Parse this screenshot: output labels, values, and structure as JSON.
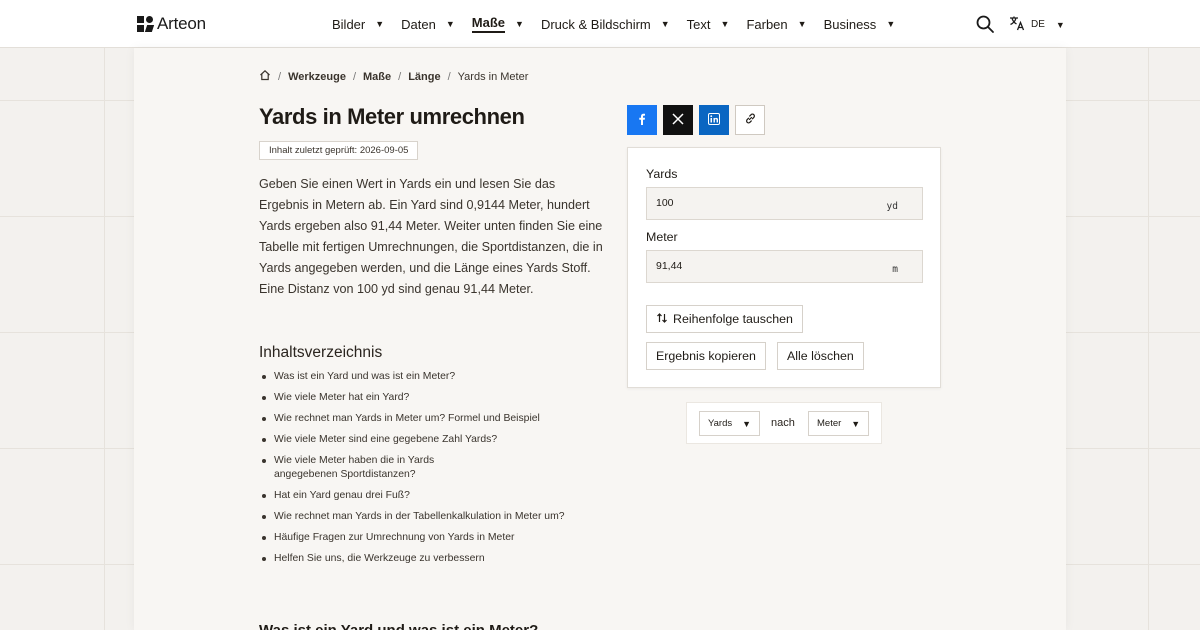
{
  "brand": {
    "name": "Arteon"
  },
  "nav": {
    "items": [
      {
        "label": "Bilder",
        "active": false
      },
      {
        "label": "Daten",
        "active": false
      },
      {
        "label": "Maße",
        "active": true
      },
      {
        "label": "Druck & Bildschirm",
        "active": false
      },
      {
        "label": "Text",
        "active": false
      },
      {
        "label": "Farben",
        "active": false
      },
      {
        "label": "Business",
        "active": false
      }
    ],
    "language": "DE"
  },
  "breadcrumb": {
    "items": [
      "Werkzeuge",
      "Maße",
      "Länge",
      "Yards in Meter"
    ]
  },
  "page": {
    "title": "Yards in Meter umrechnen",
    "checked_badge": "Inhalt zuletzt geprüft: 2026-09-05",
    "intro": "Geben Sie einen Wert in Yards ein und lesen Sie das Ergebnis in Metern ab. Ein Yard sind 0,9144 Meter, hundert Yards ergeben also 91,44 Meter. Weiter unten finden Sie eine Tabelle mit fertigen Umrechnungen, die Sportdistanzen, die in Yards angegeben werden, und die Länge eines Yards Stoff. Eine Distanz von 100 yd sind genau 91,44 Meter."
  },
  "toc": {
    "heading": "Inhaltsverzeichnis",
    "items": [
      "Was ist ein Yard und was ist ein Meter?",
      "Wie viele Meter hat ein Yard?",
      "Wie rechnet man Yards in Meter um? Formel und Beispiel",
      "Wie viele Meter sind eine gegebene Zahl Yards?",
      "Wie viele Meter haben die in Yards angegebenen Sportdistanzen?",
      "Hat ein Yard genau drei Fuß?",
      "Wie rechnet man Yards in der Tabellenkalkulation in Meter um?",
      "Häufige Fragen zur Umrechnung von Yards in Meter",
      "Helfen Sie uns, die Werkzeuge zu verbessern"
    ]
  },
  "next_section": {
    "heading": "Was ist ein Yard und was ist ein Meter?"
  },
  "share": {
    "facebook_icon": "facebook-icon",
    "x_icon": "x-icon",
    "linkedin_icon": "linkedin-icon",
    "link_icon": "link-icon"
  },
  "converter": {
    "from": {
      "label": "Yards",
      "value": "100",
      "unit": "yd"
    },
    "to": {
      "label": "Meter",
      "value": "91,44",
      "unit": "m"
    },
    "swap_label": "Reihenfolge tauschen",
    "copy_label": "Ergebnis kopieren",
    "clear_label": "Alle löschen"
  },
  "unit_selector": {
    "from": "Yards",
    "connector": "nach",
    "to": "Meter"
  },
  "colors": {
    "facebook": "#1877f2",
    "x": "#111111",
    "linkedin": "#0a66c2"
  }
}
